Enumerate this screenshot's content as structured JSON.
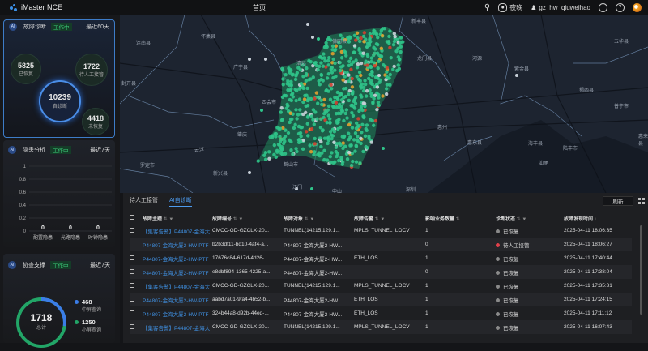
{
  "header": {
    "app": "iMaster NCE",
    "title": "首页",
    "theme_label": "夜晚",
    "user": "gz_hw_qiuweihao",
    "icons": [
      "search-icon",
      "palette-icon",
      "user-icon",
      "info-icon",
      "help-icon",
      "avatar"
    ]
  },
  "fault_diag": {
    "title": "故障诊断",
    "status": "工作中",
    "range": "最近60天",
    "center_value": "10239",
    "center_label": "自诊断",
    "recovered_value": "5825",
    "recovered_label": "已恢复",
    "manual_value": "1722",
    "manual_label": "待人工接管",
    "unrecovered_value": "4418",
    "unrecovered_label": "未恢复"
  },
  "hidden_risk": {
    "title": "隐患分析",
    "status": "工作中",
    "range": "最近7天",
    "yticks": [
      "1",
      "0.8",
      "0.6",
      "0.4",
      "0.2",
      "0"
    ],
    "chart_data": {
      "type": "bar",
      "categories": [
        "配置隐患",
        "光路隐患",
        "时钟隐患"
      ],
      "values": [
        0,
        0,
        0
      ],
      "ylim": [
        0,
        1
      ]
    }
  },
  "collab": {
    "title": "协查支撑",
    "status": "工作中",
    "range": "最近7天",
    "total": "1718",
    "total_label": "总计",
    "items": [
      {
        "value": "468",
        "label": "中屏查询",
        "color": "#3b7de8"
      },
      {
        "value": "1250",
        "label": "小屏查询",
        "color": "#22a567"
      }
    ]
  },
  "map": {
    "labels": [
      "怀集县",
      "广宁县",
      "四会市",
      "肇庆",
      "云浮",
      "罗定市",
      "新兴县",
      "鹤山市",
      "江门",
      "中山",
      "清远",
      "新丰县",
      "龙门县",
      "河源",
      "紫金县",
      "惠州",
      "惠东县",
      "海丰县",
      "陆丰市",
      "汕尾",
      "五华县",
      "普宁市",
      "惠来县",
      "揭西县",
      "深圳",
      "连南县",
      "封开县",
      "佛冈县"
    ]
  },
  "table": {
    "tabs": [
      "待人工接管",
      "AI自诊断"
    ],
    "active_tab": 1,
    "refresh": "刷新",
    "columns": [
      "故障主题",
      "故障编号",
      "故障对象",
      "故障告警",
      "影响业务数量",
      "诊断状态",
      "故障发现时间"
    ],
    "rows": [
      [
        "【集客告警】P44807-金海大",
        "CMCC-GD-GZCLX-20...",
        "TUNNEL(14215,129.1...",
        "MPLS_TUNNEL_LOCV",
        "1",
        "已恢复",
        "2025-04-11 18:06:35"
      ],
      [
        "P44807-金海大厦2-HW-PTF",
        "b2b3df11-bd10-4af4-a...",
        "P44807-金海大厦2-HW...",
        "",
        "0",
        "待人工接管",
        "2025-04-11 18:06:27"
      ],
      [
        "P44807-金海大厦2-HW-PTF",
        "17676c84-617d-4d26-...",
        "P44807-金海大厦2-HW...",
        "ETH_LOS",
        "1",
        "已恢复",
        "2025-04-11 17:40:44"
      ],
      [
        "P44807-金海大厦2-HW-PTF",
        "e8dbf894-1365-4225-a...",
        "P44807-金海大厦2-HW...",
        "",
        "0",
        "已恢复",
        "2025-04-11 17:38:04"
      ],
      [
        "【集客告警】P44807-金海大",
        "CMCC-GD-GZCLX-20...",
        "TUNNEL(14215,129.1...",
        "MPLS_TUNNEL_LOCV",
        "1",
        "已恢复",
        "2025-04-11 17:35:31"
      ],
      [
        "P44807-金海大厦2-HW-PTF",
        "aabd7a01-9fa4-4b52-b...",
        "P44807-金海大厦2-HW...",
        "ETH_LOS",
        "1",
        "已恢复",
        "2025-04-11 17:24:15"
      ],
      [
        "P44807-金海大厦2-HW-PTF",
        "324b44a8-d92b-44ed-...",
        "P44807-金海大厦2-HW...",
        "ETH_LOS",
        "1",
        "已恢复",
        "2025-04-11 17:11:12"
      ],
      [
        "【集客告警】P44807-金海大",
        "CMCC-GD-GZCLX-20...",
        "TUNNEL(14215,129.1...",
        "MPLS_TUNNEL_LOCV",
        "1",
        "已恢复",
        "2025-04-11 16:07:43"
      ]
    ],
    "status_colors": {
      "已恢复": "#8a8a8a",
      "待人工接管": "#e0404a"
    }
  }
}
